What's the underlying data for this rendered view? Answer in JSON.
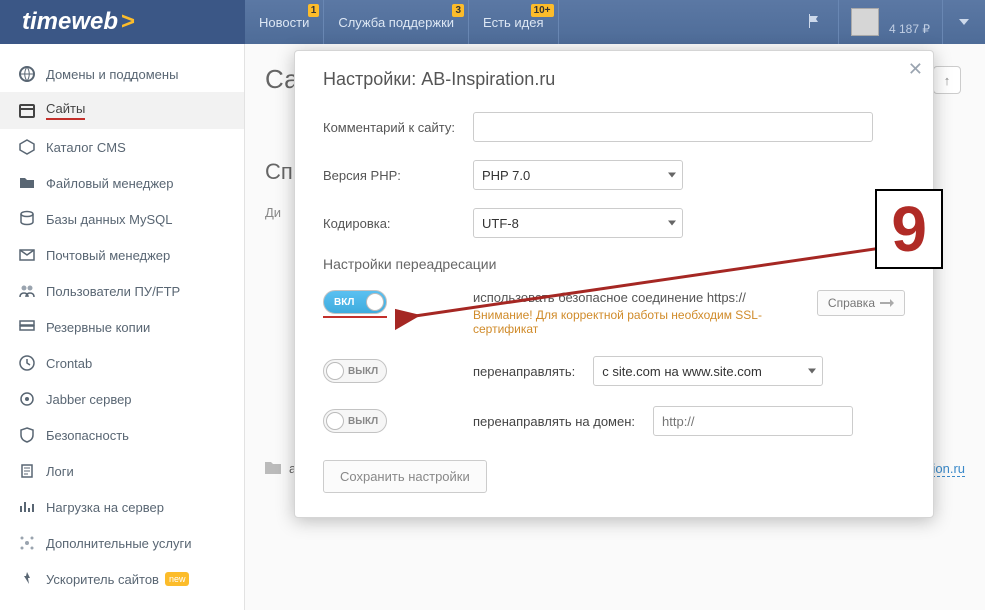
{
  "header": {
    "logo": "timeweb",
    "nav": [
      {
        "label": "Новости",
        "badge": "1"
      },
      {
        "label": "Служба поддержки",
        "badge": "3"
      },
      {
        "label": "Есть идея",
        "badge": "10+"
      }
    ],
    "balance": "4 187 ₽"
  },
  "sidebar": [
    {
      "label": "Домены и поддомены",
      "icon": "globe"
    },
    {
      "label": "Сайты",
      "icon": "sites",
      "active": true,
      "underline": true
    },
    {
      "label": "Каталог CMS",
      "icon": "box"
    },
    {
      "label": "Файловый менеджер",
      "icon": "folder"
    },
    {
      "label": "Базы данных MySQL",
      "icon": "db"
    },
    {
      "label": "Почтовый менеджер",
      "icon": "mail"
    },
    {
      "label": "Пользователи ПУ/FTP",
      "icon": "users"
    },
    {
      "label": "Резервные копии",
      "icon": "backup"
    },
    {
      "label": "Crontab",
      "icon": "cron"
    },
    {
      "label": "Jabber сервер",
      "icon": "jabber"
    },
    {
      "label": "Безопасность",
      "icon": "shield"
    },
    {
      "label": "Логи",
      "icon": "logs"
    },
    {
      "label": "Нагрузка на сервер",
      "icon": "load"
    },
    {
      "label": "Дополнительные услуги",
      "icon": "extra"
    },
    {
      "label": "Ускоритель сайтов",
      "icon": "speed",
      "new": true
    }
  ],
  "page": {
    "title_prefix": "Са",
    "sp_prefix": "Сп",
    "di_prefix": "Ди",
    "folder_name": "ab-inspiration.ru",
    "folder_link": "ab-inspiration.ru"
  },
  "modal": {
    "title": "Настройки: AB-Inspiration.ru",
    "comment_label": "Комментарий к сайту:",
    "php_label": "Версия PHP:",
    "php_value": "PHP 7.0",
    "enc_label": "Кодировка:",
    "enc_value": "UTF-8",
    "redir_section": "Настройки переадресации",
    "toggle_on": "ВКЛ",
    "toggle_off": "ВЫКЛ",
    "https_text": "использовать безопасное соединение https://",
    "https_warn": "Внимание! Для корректной работы необходим SSL-сертификат",
    "help": "Справка",
    "redir_label": "перенаправлять:",
    "redir_value": "с site.com на www.site.com",
    "domain_label": "перенаправлять на домен:",
    "domain_placeholder": "http://",
    "save": "Сохранить настройки"
  },
  "anno": {
    "number": "9"
  },
  "badges": {
    "new": "new"
  }
}
